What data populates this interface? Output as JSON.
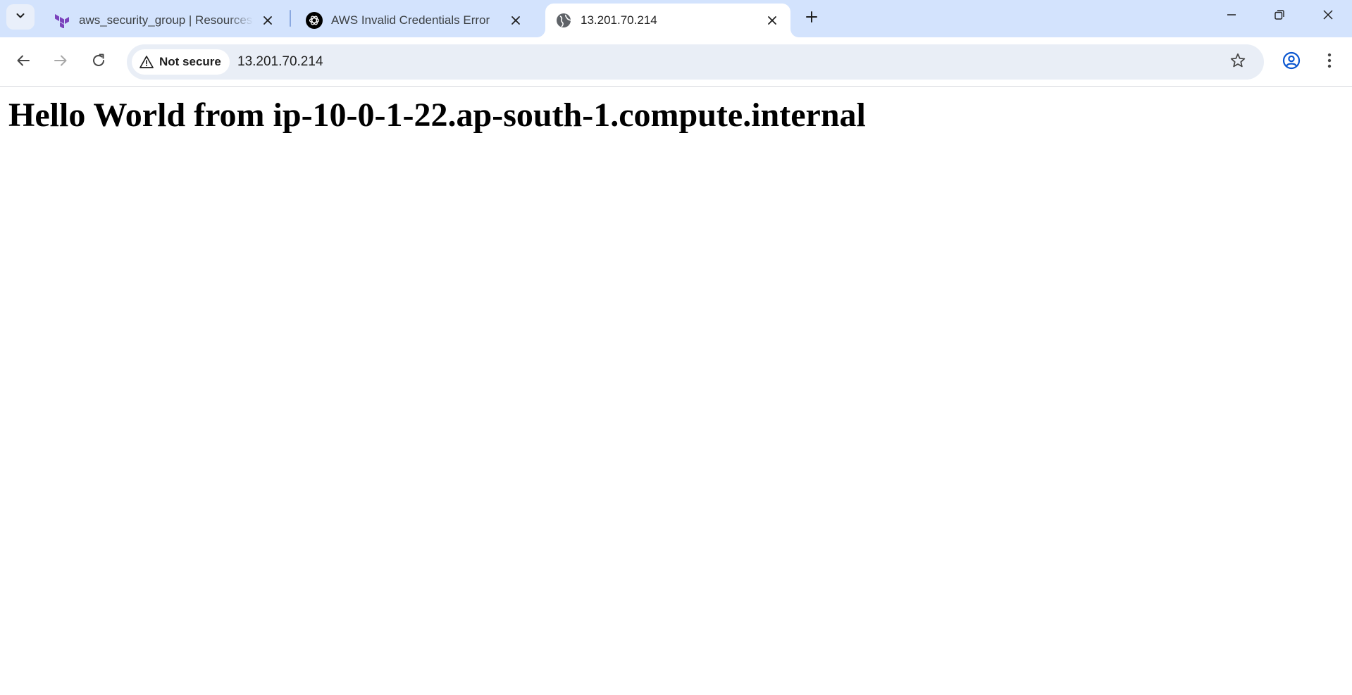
{
  "colors": {
    "tabstrip_bg": "#d3e3fd",
    "active_tab_bg": "#ffffff",
    "omnibox_bg": "#e9eef6",
    "profile_accent": "#0b57d0",
    "terraform_purple": "#7b42bc"
  },
  "browser": {
    "tab_search_icon": "chevron-down-icon",
    "tabs": [
      {
        "title": "aws_security_group | Resources",
        "favicon": "terraform-icon",
        "active": false
      },
      {
        "title": "AWS Invalid Credentials Error",
        "favicon": "openai-icon",
        "active": false
      },
      {
        "title": "13.201.70.214",
        "favicon": "globe-icon",
        "active": true
      }
    ],
    "new_tab_icon": "plus-icon",
    "window_controls": [
      "minimize-icon",
      "restore-icon",
      "close-icon"
    ]
  },
  "toolbar": {
    "security_label": "Not secure",
    "url": "13.201.70.214",
    "icons": [
      "back-arrow-icon",
      "forward-arrow-icon",
      "reload-icon",
      "warning-triangle-icon",
      "star-icon",
      "profile-icon",
      "kebab-menu-icon"
    ]
  },
  "page": {
    "heading": "Hello World from ip-10-0-1-22.ap-south-1.compute.internal"
  }
}
